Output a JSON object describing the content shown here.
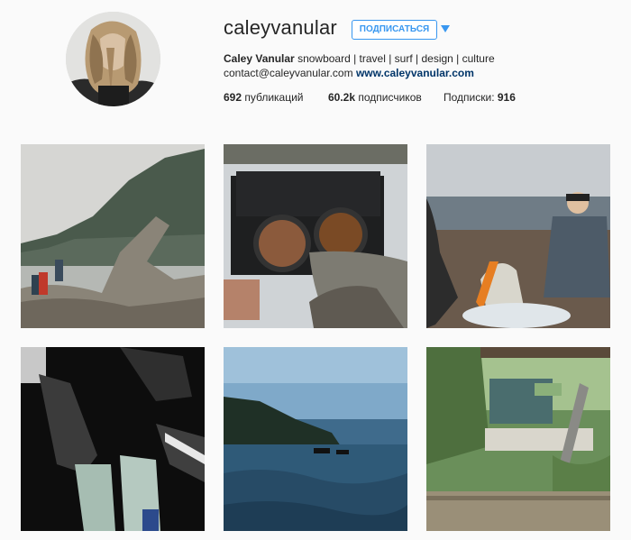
{
  "profile": {
    "username": "caleyvanular",
    "follow_label": "ПОДПИСАТЬСЯ",
    "full_name": "Caley Vanular",
    "bio_text": "snowboard | travel | surf | design | culture",
    "email": "contact@caleyvanular.com",
    "website": "www.caleyvanular.com"
  },
  "stats": {
    "posts_count": "692",
    "posts_label": "публикаций",
    "followers_count": "60.2k",
    "followers_label": "подписчиков",
    "following_label": "Подписки:",
    "following_count": "916"
  },
  "colors": {
    "accent": "#3897f0",
    "link": "#003569",
    "background": "#fafafa"
  },
  "icons": {
    "dropdown": "chevron-down-icon"
  },
  "posts": [
    {
      "subject": "driftwood-coast"
    },
    {
      "subject": "camp-stove-cooking"
    },
    {
      "subject": "beach-friends"
    },
    {
      "subject": "shoes-circle"
    },
    {
      "subject": "surfers-ocean"
    },
    {
      "subject": "outdoor-kitchen"
    }
  ]
}
